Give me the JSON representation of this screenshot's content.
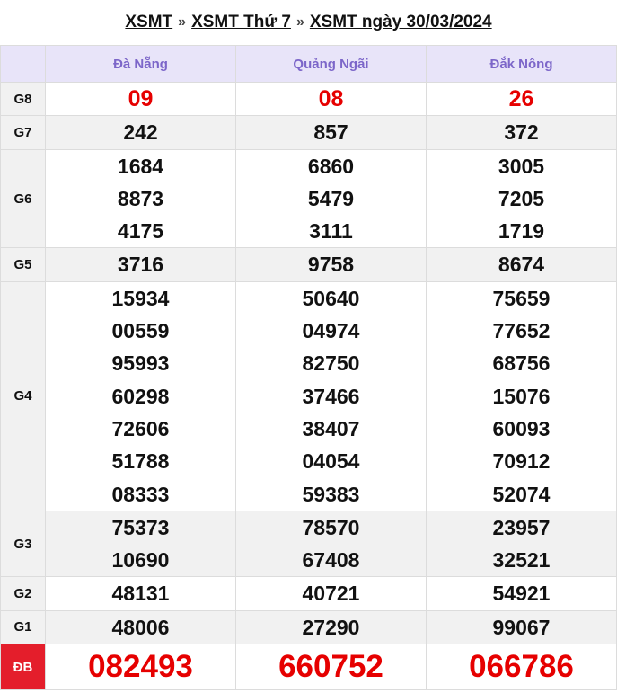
{
  "breadcrumb": {
    "item1": "XSMT",
    "item2": "XSMT Thứ 7",
    "item3": "XSMT ngày 30/03/2024",
    "separator": "»"
  },
  "table": {
    "provinces": [
      "Đà Nẵng",
      "Quảng Ngãi",
      "Đắk Nông"
    ],
    "prizes": [
      {
        "label": "G8",
        "cols": [
          [
            "09"
          ],
          [
            "08"
          ],
          [
            "26"
          ]
        ]
      },
      {
        "label": "G7",
        "cols": [
          [
            "242"
          ],
          [
            "857"
          ],
          [
            "372"
          ]
        ]
      },
      {
        "label": "G6",
        "cols": [
          [
            "1684",
            "8873",
            "4175"
          ],
          [
            "6860",
            "5479",
            "3111"
          ],
          [
            "3005",
            "7205",
            "1719"
          ]
        ]
      },
      {
        "label": "G5",
        "cols": [
          [
            "3716"
          ],
          [
            "9758"
          ],
          [
            "8674"
          ]
        ]
      },
      {
        "label": "G4",
        "cols": [
          [
            "15934",
            "00559",
            "95993",
            "60298",
            "72606",
            "51788",
            "08333"
          ],
          [
            "50640",
            "04974",
            "82750",
            "37466",
            "38407",
            "04054",
            "59383"
          ],
          [
            "75659",
            "77652",
            "68756",
            "15076",
            "60093",
            "70912",
            "52074"
          ]
        ]
      },
      {
        "label": "G3",
        "cols": [
          [
            "75373",
            "10690"
          ],
          [
            "78570",
            "67408"
          ],
          [
            "23957",
            "32521"
          ]
        ]
      },
      {
        "label": "G2",
        "cols": [
          [
            "48131"
          ],
          [
            "40721"
          ],
          [
            "54921"
          ]
        ]
      },
      {
        "label": "G1",
        "cols": [
          [
            "48006"
          ],
          [
            "27290"
          ],
          [
            "99067"
          ]
        ]
      },
      {
        "label": "ĐB",
        "cols": [
          [
            "082493"
          ],
          [
            "660752"
          ],
          [
            "066786"
          ]
        ]
      }
    ]
  },
  "colors": {
    "header_bg": "#e8e4f9",
    "header_text": "#7c66c9",
    "highlight_red": "#e60000",
    "special_label_bg": "#e41e2b"
  }
}
